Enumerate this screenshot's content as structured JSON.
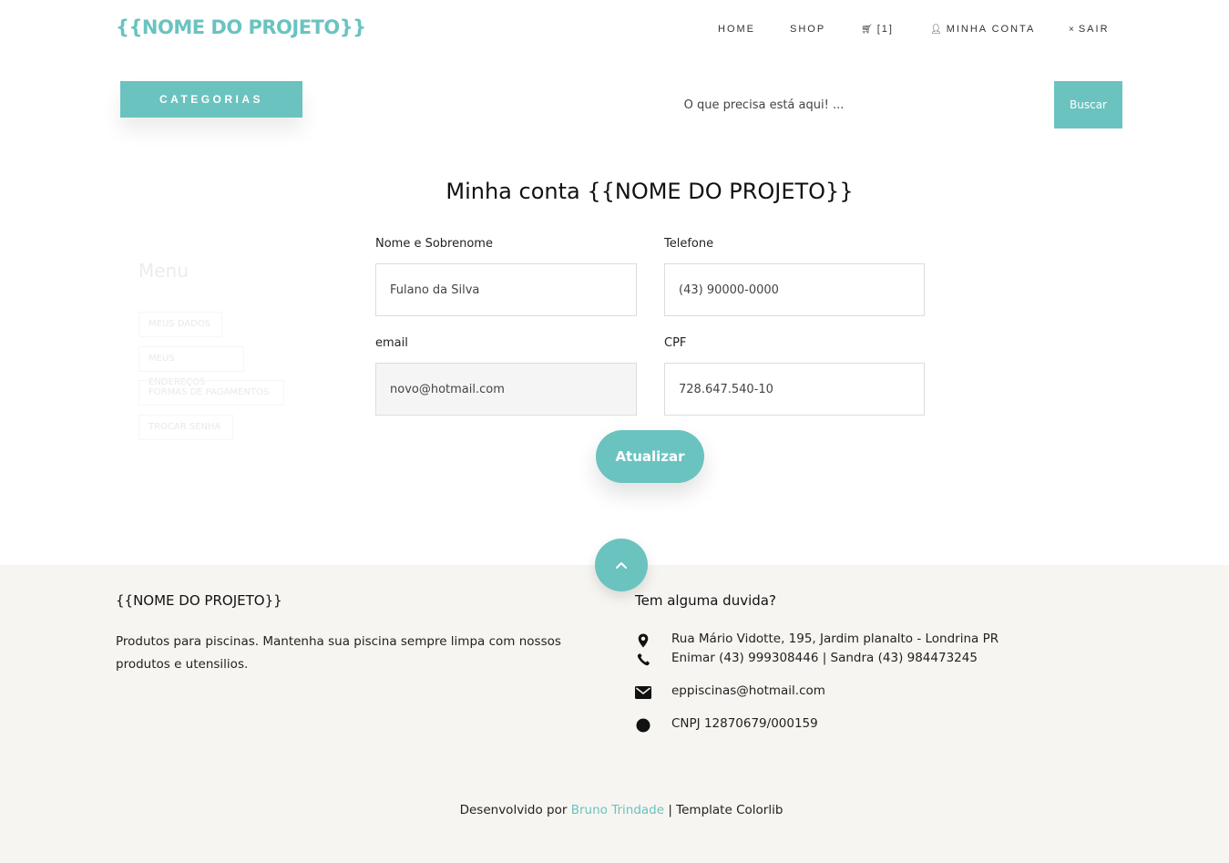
{
  "header": {
    "logo": "{{NOME DO PROJETO}}",
    "nav": {
      "home": "HOME",
      "shop": "SHOP",
      "cart": "[1]",
      "account": "MINHA CONTA",
      "logout": "SAIR"
    }
  },
  "search": {
    "categories_label": "CATEGORIAS",
    "placeholder": "O que precisa está aqui! ...",
    "button_label": "Buscar"
  },
  "account": {
    "title": "Minha conta {{NOME DO PROJETO}}",
    "menu": {
      "title": "Menu",
      "items": [
        "MEUS DADOS",
        "MEUS ENDEREÇOS",
        "FORMAS DE PAGAMENTOS",
        "TROCAR SENHA"
      ]
    },
    "form": {
      "name_label": "Nome e Sobrenome",
      "name_value": "Fulano da Silva",
      "phone_label": "Telefone",
      "phone_value": "(43) 90000-0000",
      "email_label": "email",
      "email_value": "novo@hotmail.com",
      "cpf_label": "CPF",
      "cpf_value": "728.647.540-10",
      "submit_label": "Atualizar"
    }
  },
  "footer": {
    "brand": "{{NOME DO PROJETO}}",
    "description": "Produtos para piscinas. Mantenha sua piscina sempre limpa com nossos produtos e utensilios.",
    "contact_heading": "Tem alguma duvida?",
    "address": "Rua Mário Vidotte, 195, Jardim planalto - Londrina PR",
    "phone": "Enimar (43) 999308446 | Sandra (43) 984473245",
    "email": "eppiscinas@hotmail.com",
    "cnpj": "CNPJ 12870679/000159",
    "credits": {
      "prefix": "Desenvolvido por ",
      "author": "Bruno Trindade",
      "suffix": " | Template Colorlib"
    }
  },
  "colors": {
    "accent": "#6ac3bf",
    "footer_bg": "#f6f5f1"
  },
  "icons": [
    "cart-icon",
    "user-icon",
    "close-icon",
    "map-marker-icon",
    "phone-icon",
    "envelope-icon",
    "circle-icon",
    "chevron-up-icon"
  ]
}
